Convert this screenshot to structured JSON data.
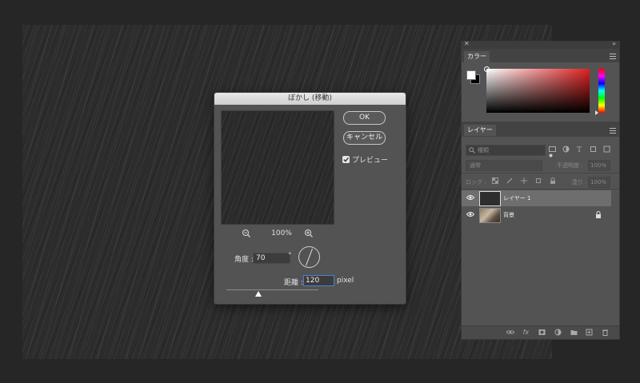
{
  "dialog": {
    "title": "ぼかし (移動)",
    "ok_label": "OK",
    "cancel_label": "キャンセル",
    "preview_label": "プレビュー",
    "preview_checked": true,
    "zoom_level": "100%",
    "angle_label": "角度 :",
    "angle_value": "70",
    "angle_unit": "°",
    "distance_label": "距離 :",
    "distance_value": "120",
    "distance_unit": "pixel",
    "distance_slider_fraction": 0.35
  },
  "color_panel": {
    "tab_label": "カラー",
    "foreground": "#ffffff",
    "background": "#000000",
    "hue_color": "#e02020"
  },
  "layers_panel": {
    "tab_label": "レイヤー",
    "search_placeholder": "種類",
    "blend_mode": "通常",
    "opacity_label": "不透明度 :",
    "opacity_value": "100%",
    "lock_label": "ロック :",
    "fill_label": "塗り :",
    "fill_value": "100%",
    "layers": [
      {
        "name": "レイヤー 1",
        "selected": true,
        "visible": true,
        "locked": false
      },
      {
        "name": "背景",
        "selected": false,
        "visible": true,
        "locked": true
      }
    ]
  },
  "colors": {
    "canvas_bg": "#2c2c2c",
    "panel_bg": "#535353",
    "selected_row": "#6e6e6e",
    "focus_border": "#4a82d6"
  }
}
